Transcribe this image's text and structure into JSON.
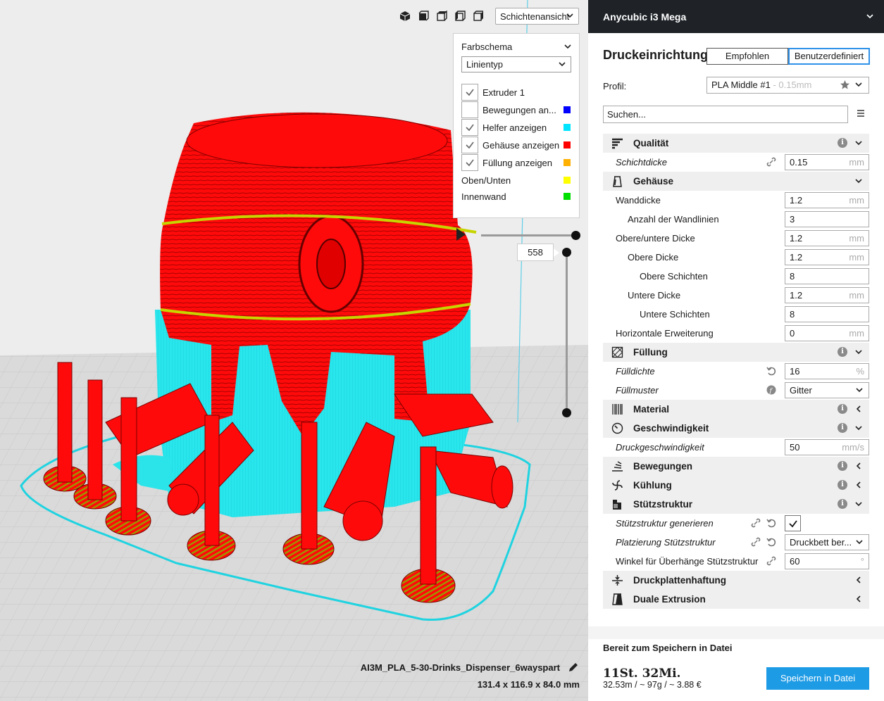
{
  "viewport": {
    "view_mode": "Schichtenansicht",
    "color_scheme_title": "Farbschema",
    "line_type": "Linientyp",
    "legend": [
      {
        "label": "Extruder 1",
        "checked": true,
        "color": null
      },
      {
        "label": "Bewegungen an...",
        "checked": false,
        "color": "#0000ff"
      },
      {
        "label": "Helfer anzeigen",
        "checked": true,
        "color": "#00e5ff"
      },
      {
        "label": "Gehäuse anzeigen",
        "checked": true,
        "color": "#ff0000"
      },
      {
        "label": "Füllung anzeigen",
        "checked": true,
        "color": "#ffb000"
      },
      {
        "label": "Oben/Unten",
        "checked": null,
        "color": "#ffff00"
      },
      {
        "label": "Innenwand",
        "checked": null,
        "color": "#00e000"
      }
    ],
    "current_layer": "558",
    "job_name": "AI3M_PLA_5-30-Drinks_Dispenser_6wayspart",
    "job_dimensions": "131.4 x 116.9 x 84.0 mm"
  },
  "sidebar": {
    "machine_name": "Anycubic i3 Mega",
    "setup_title": "Druckeinrichtung",
    "mode_recommended": "Empfohlen",
    "mode_custom": "Benutzerdefiniert",
    "profile_label": "Profil:",
    "profile_name": "PLA Middle #1",
    "profile_layer": " - 0.15mm",
    "search_placeholder": "Suchen...",
    "categories": {
      "quality": "Qualität",
      "shell": "Gehäuse",
      "infill": "Füllung",
      "material": "Material",
      "speed": "Geschwindigkeit",
      "travel": "Bewegungen",
      "cooling": "Kühlung",
      "support": "Stützstruktur",
      "adhesion": "Druckplattenhaftung",
      "dual": "Duale Extrusion"
    },
    "settings": {
      "layer_height": {
        "label": "Schichtdicke",
        "value": "0.15",
        "unit": "mm"
      },
      "wall_thickness": {
        "label": "Wanddicke",
        "value": "1.2",
        "unit": "mm"
      },
      "wall_line_count": {
        "label": "Anzahl der Wandlinien",
        "value": "3"
      },
      "top_bottom_thickness": {
        "label": "Obere/untere Dicke",
        "value": "1.2",
        "unit": "mm"
      },
      "top_thickness": {
        "label": "Obere Dicke",
        "value": "1.2",
        "unit": "mm"
      },
      "top_layers": {
        "label": "Obere Schichten",
        "value": "8"
      },
      "bottom_thickness": {
        "label": "Untere Dicke",
        "value": "1.2",
        "unit": "mm"
      },
      "bottom_layers": {
        "label": "Untere Schichten",
        "value": "8"
      },
      "horizontal_expansion": {
        "label": "Horizontale Erweiterung",
        "value": "0",
        "unit": "mm"
      },
      "infill_density": {
        "label": "Fülldichte",
        "value": "16",
        "unit": "%"
      },
      "infill_pattern": {
        "label": "Füllmuster",
        "value": "Gitter"
      },
      "print_speed": {
        "label": "Druckgeschwindigkeit",
        "value": "50",
        "unit": "mm/s"
      },
      "support_enable": {
        "label": "Stützstruktur generieren",
        "checked": true
      },
      "support_placement": {
        "label": "Platzierung Stützstruktur",
        "value": "Druckbett ber..."
      },
      "support_angle": {
        "label": "Winkel für Überhänge Stützstruktur",
        "value": "60",
        "unit": "°"
      }
    },
    "status": "Bereit zum Speichern in Datei",
    "print_time": "11St. 32Mi.",
    "print_stats": "32.53m / ~ 97g / ~ 3.88 €",
    "save_button": "Speichern in Datei"
  }
}
